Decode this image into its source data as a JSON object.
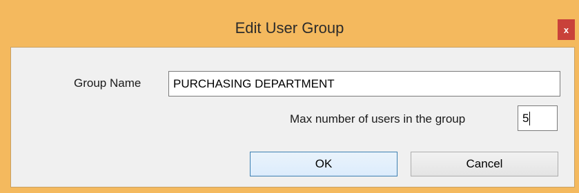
{
  "window": {
    "title": "Edit User Group",
    "close_label": "x"
  },
  "form": {
    "group_name_label": "Group Name",
    "group_name_value": "PURCHASING DEPARTMENT",
    "max_users_label": "Max number of users in the group",
    "max_users_value": "5"
  },
  "buttons": {
    "ok_label": "OK",
    "cancel_label": "Cancel"
  },
  "colors": {
    "frame": "#f4b95e",
    "close": "#c9413a",
    "client": "#f0f0f0"
  }
}
